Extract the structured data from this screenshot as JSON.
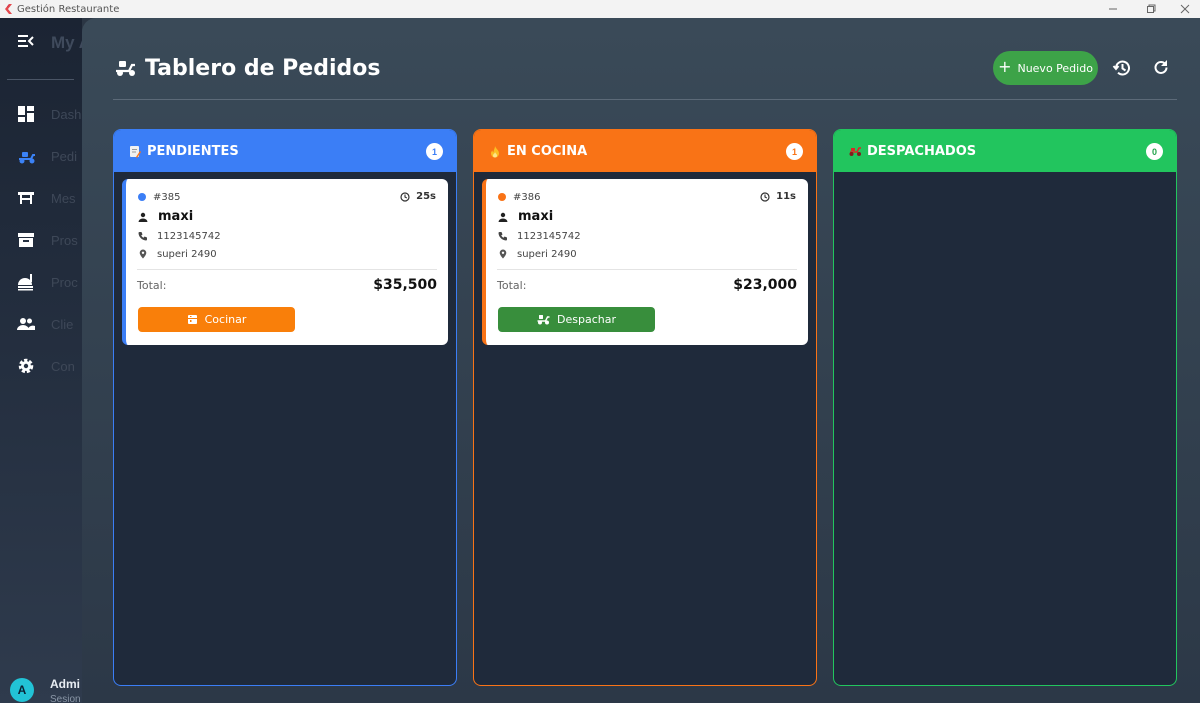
{
  "window": {
    "title": "Gestión Restaurante"
  },
  "sidebar": {
    "brand": "My A",
    "items": [
      {
        "label": "Dash",
        "icon": "dashboard-icon"
      },
      {
        "label": "Pedi",
        "icon": "delivery-icon"
      },
      {
        "label": "Mes",
        "icon": "table-icon"
      },
      {
        "label": "Pros",
        "icon": "archive-icon"
      },
      {
        "label": "Proc",
        "icon": "kitchen-icon"
      },
      {
        "label": "Clie",
        "icon": "people-icon"
      },
      {
        "label": "Con",
        "icon": "gear-icon"
      }
    ],
    "user": {
      "initial": "A",
      "name": "Admi",
      "sub": "Sesion"
    }
  },
  "header": {
    "title": "Tablero de Pedidos",
    "new_order_label": "Nuevo Pedido"
  },
  "columns": [
    {
      "title": "PENDIENTES",
      "count": "1",
      "color": "#3b7ef6",
      "icon": "note-icon"
    },
    {
      "title": "EN COCINA",
      "count": "1",
      "color": "#f97316",
      "icon": "fire-icon"
    },
    {
      "title": "DESPACHADOS",
      "count": "0",
      "color": "#22c55e",
      "icon": "scooter-icon"
    }
  ],
  "orders": [
    {
      "id": "#385",
      "elapsed": "25s",
      "customer": "maxi",
      "phone": "1123145742",
      "address": "superi 2490",
      "total_label": "Total:",
      "total": "$35,500",
      "action_label": "Cocinar",
      "action_color": "#f97f0a",
      "accent": "#3b7ef6"
    },
    {
      "id": "#386",
      "elapsed": "11s",
      "customer": "maxi",
      "phone": "1123145742",
      "address": "superi 2490",
      "total_label": "Total:",
      "total": "$23,000",
      "action_label": "Despachar",
      "action_color": "#388e3c",
      "accent": "#f97316"
    }
  ]
}
